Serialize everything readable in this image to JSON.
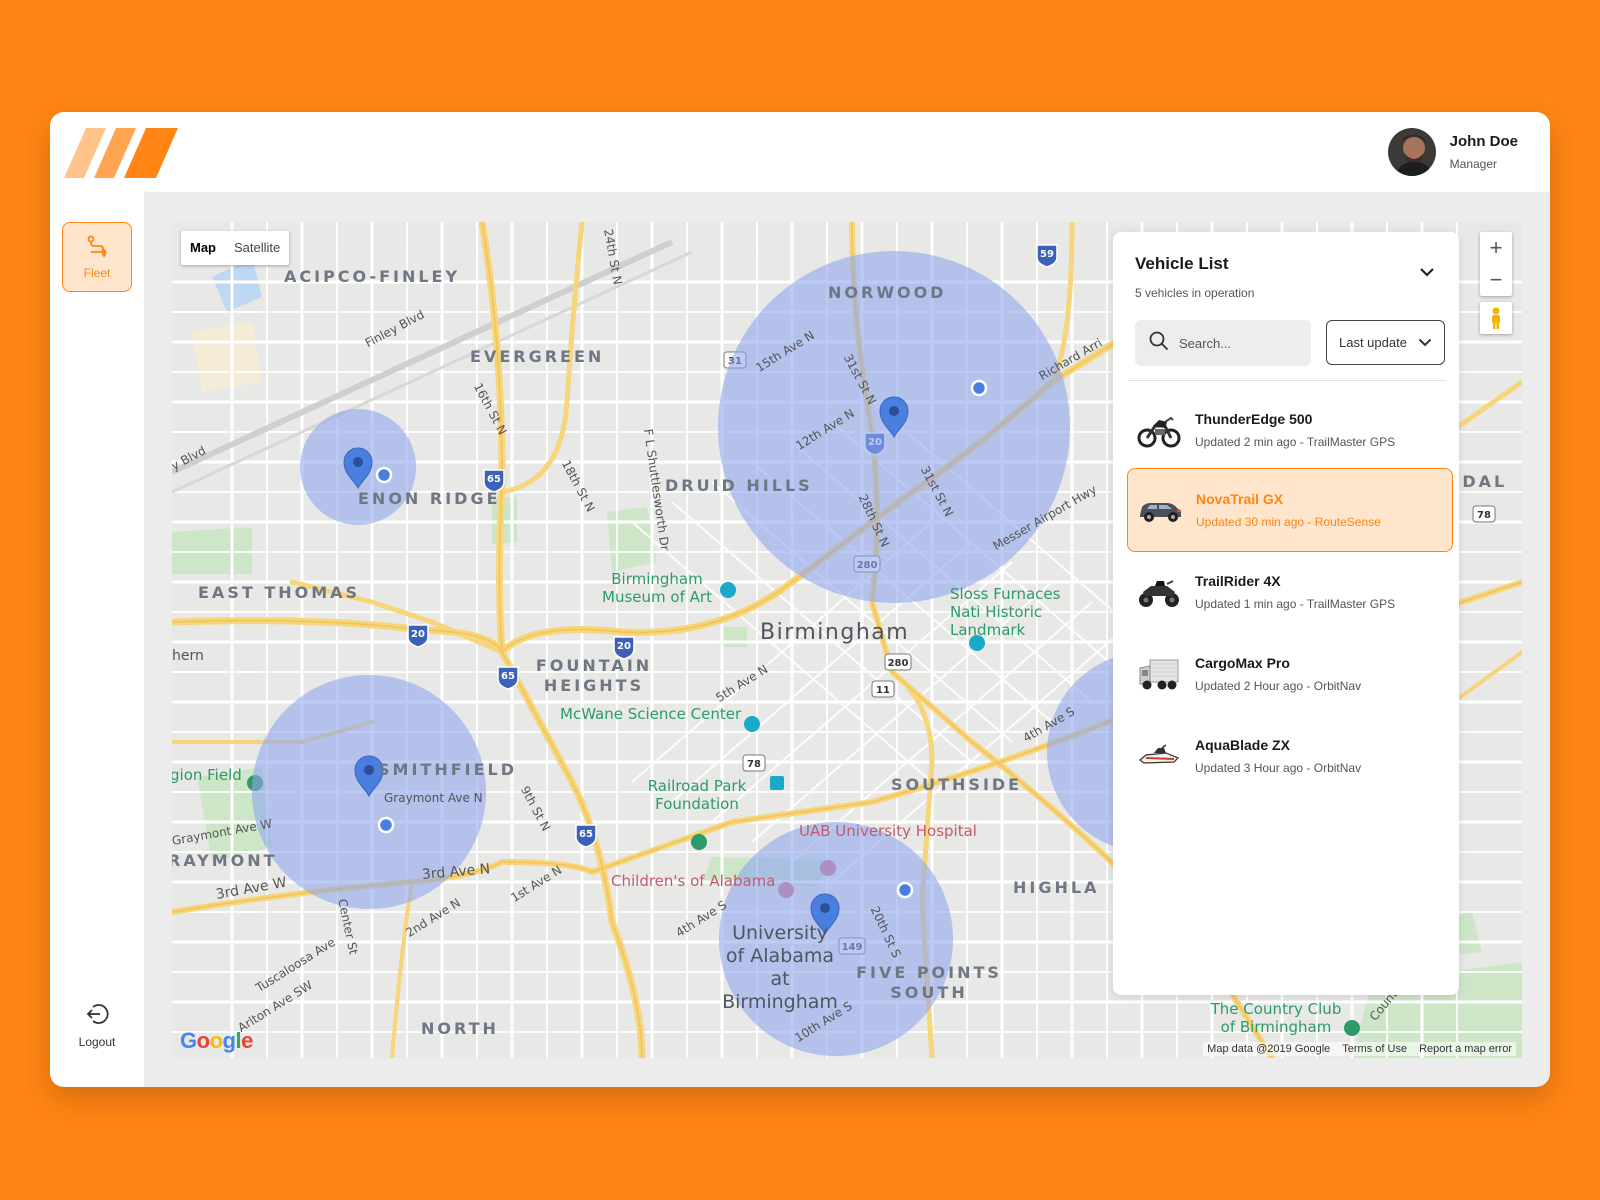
{
  "header": {
    "user": {
      "name": "John Doe",
      "role": "Manager"
    }
  },
  "sidebar": {
    "fleet_label": "Fleet",
    "logout_label": "Logout"
  },
  "map": {
    "map_type": {
      "map": "Map",
      "satellite": "Satellite",
      "selected": "Map"
    },
    "neighborhoods": [
      "ACIPCO-FINLEY",
      "EVERGREEN",
      "NORWOOD",
      "ENON RIDGE",
      "DRUID HILLS",
      "EAST THOMAS",
      "FOUNTAIN HEIGHTS",
      "SMITHFIELD",
      "RAYMONT",
      "SOUTHSIDE",
      "FIVE POINTS SOUTH",
      "NORTH",
      "HIGHLA",
      "NDAL"
    ],
    "city": "Birmingham",
    "pois": {
      "museum": "Birmingham Museum of Art",
      "mcwane": "McWane Science Center",
      "railroad": "Railroad Park Foundation",
      "sloss": "Sloss Furnaces Nati Historic Landmark",
      "uab_hospital": "UAB University Hospital",
      "childrens": "Children's of Alabama",
      "uab": "University of Alabama at Birmingham",
      "country_club": "The Country Club of Birmingham",
      "legion": "gion Field"
    },
    "streets": [
      "Finley Blvd",
      "15th Ave N",
      "31st St N",
      "12th Ave N",
      "16th St N",
      "18th St N",
      "F L Shuttlesworth Dr",
      "28th St N",
      "31st St N",
      "Messer Airport Hwy",
      "Richard Arri",
      "24th St N",
      "y Blvd",
      "5th Ave N",
      "4th Ave S",
      "Graymont Ave N",
      "Graymont Ave W",
      "3rd Ave W",
      "3rd Ave N",
      "9th St N",
      "1st Ave N",
      "2nd Ave N",
      "Center St",
      "4th Ave S",
      "20th St S",
      "10th Ave S",
      "Tuscaloosa Ave",
      "Arlton Ave SW",
      "hern",
      "Country Club"
    ],
    "highways": [
      "59",
      "31",
      "20",
      "65",
      "280",
      "20",
      "20",
      "65",
      "280",
      "11",
      "78",
      "65",
      "149",
      "78"
    ],
    "controls": {
      "zoom_in": "+",
      "zoom_out": "−"
    },
    "google_logo": "Google",
    "attribution": {
      "data": "Map data @2019 Google",
      "terms": "Terms of Use",
      "report": "Report a map error"
    }
  },
  "vehicle_list": {
    "title": "Vehicle List",
    "subtitle": "5 vehicles in operation",
    "search_placeholder": "Search...",
    "sort_label": "Last update",
    "vehicles": [
      {
        "name": "ThunderEdge 500",
        "status": "Updated 2 min ago - TrailMaster GPS",
        "icon": "motorcycle-icon",
        "selected": false
      },
      {
        "name": "NovaTrail GX",
        "status": "Updated 30 min ago - RouteSense",
        "icon": "suv-icon",
        "selected": true
      },
      {
        "name": "TrailRider 4X",
        "status": "Updated 1 min ago - TrailMaster GPS",
        "icon": "atv-icon",
        "selected": false
      },
      {
        "name": "CargoMax Pro",
        "status": "Updated 2 Hour ago - OrbitNav",
        "icon": "truck-icon",
        "selected": false
      },
      {
        "name": "AquaBlade ZX",
        "status": "Updated 3 Hour ago - OrbitNav",
        "icon": "jetski-icon",
        "selected": false
      }
    ]
  },
  "colors": {
    "background": "#FF8514",
    "accent": "#FF8514",
    "accent_light": "#FFE5CC",
    "zone": "#8FA6EE",
    "marker": "#4A7FE0"
  }
}
